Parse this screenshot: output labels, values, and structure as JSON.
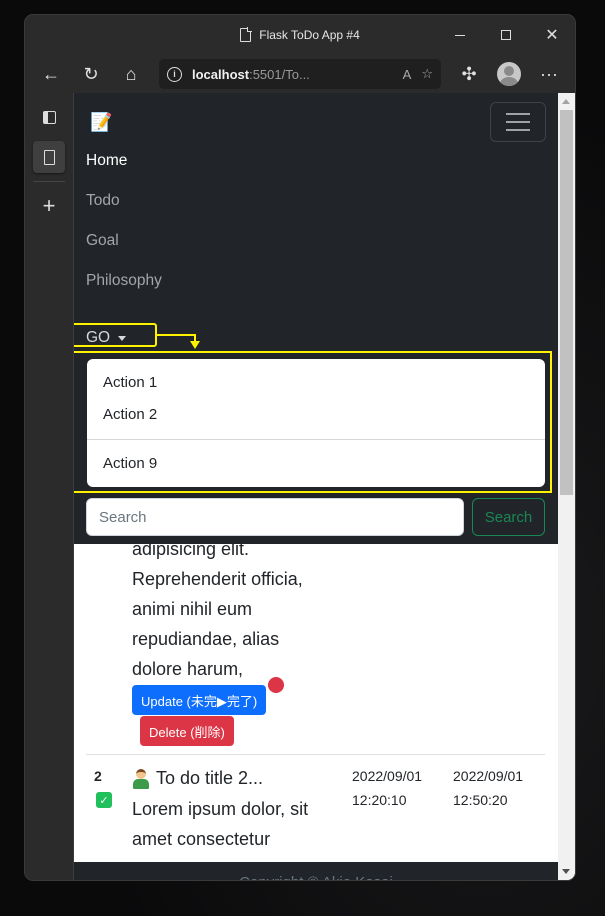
{
  "window": {
    "title": "Flask ToDo App #4",
    "controls": {
      "minimize": "minimize",
      "maximize": "maximize",
      "close": "✕"
    }
  },
  "toolbar": {
    "back": "←",
    "refresh": "↻",
    "home": "⌂",
    "url_host": "localhost",
    "url_rest": ":5501/To...",
    "read_aloud": "A",
    "favorite": "☆",
    "extensions": "✣",
    "more": "···"
  },
  "sidetabs": {
    "add": "+"
  },
  "navbar": {
    "brand_icon": "📝",
    "links": [
      {
        "label": "Home",
        "active": true
      },
      {
        "label": "Todo",
        "active": false
      },
      {
        "label": "Goal",
        "active": false
      },
      {
        "label": "Philosophy",
        "active": false
      }
    ],
    "dropdown": {
      "label": "GO",
      "items": [
        "Action 1",
        "Action 2",
        "Action 9"
      ]
    },
    "search": {
      "placeholder": "Search",
      "button": "Search"
    }
  },
  "todos": [
    {
      "description_lines": [
        "adipisicing elit.",
        "Reprehenderit officia,",
        "animi nihil eum",
        "repudiandae, alias",
        "dolore harum,"
      ],
      "update_label": "Update (未完▶完了)",
      "delete_label": "Delete (削除)"
    },
    {
      "id": "2",
      "checked": true,
      "title": "To do title 2...",
      "description_lines": [
        "Lorem ipsum dolor, sit",
        "amet consectetur"
      ],
      "created_date": "2022/09/01",
      "created_time": "12:20:10",
      "updated_date": "2022/09/01",
      "updated_time": "12:50:20"
    }
  ],
  "footer": {
    "text": "Copyright © Akio Kasai"
  },
  "colors": {
    "navbar_bg": "#212529",
    "highlight": "#fff200",
    "primary": "#0d6efd",
    "danger": "#dc3545",
    "success": "#198754"
  }
}
